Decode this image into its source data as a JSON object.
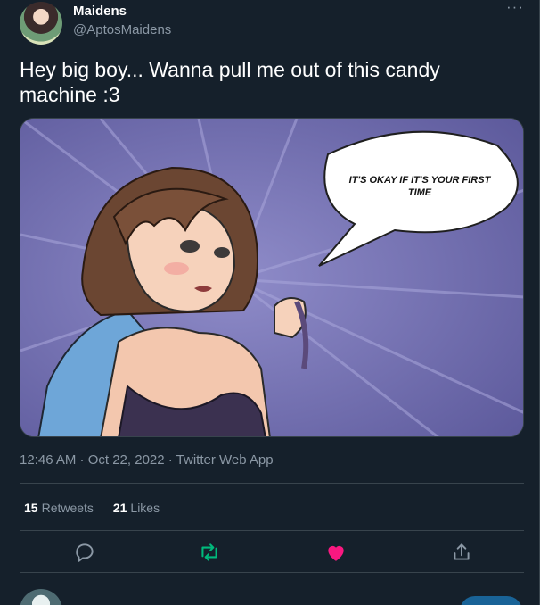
{
  "tweet": {
    "display_name": "Maidens",
    "handle": "@AptosMaidens",
    "more_label": "···",
    "text": "Hey big boy...  Wanna pull me out of this candy machine :3",
    "image": {
      "speech_bubble_text_line1": "IT'S OKAY IF IT'S YOUR FIRST",
      "speech_bubble_text_line2": "TIME"
    },
    "timestamp": "12:46 AM · Oct 22, 2022 · Twitter Web App",
    "retweets_count": "15",
    "retweets_label": "Retweets",
    "likes_count": "21",
    "likes_label": "Likes"
  },
  "actions": {
    "reply_icon": "reply-icon",
    "retweet_icon": "retweet-icon",
    "like_icon": "heart-icon",
    "share_icon": "share-icon"
  },
  "colors": {
    "background": "#15202b",
    "secondary_text": "#8b98a5",
    "divider": "#38444d",
    "retweet_green": "#00ba7c",
    "like_pink": "#f91880",
    "accent_blue": "#1d9bf0",
    "image_purple": "#6d6aa9"
  }
}
